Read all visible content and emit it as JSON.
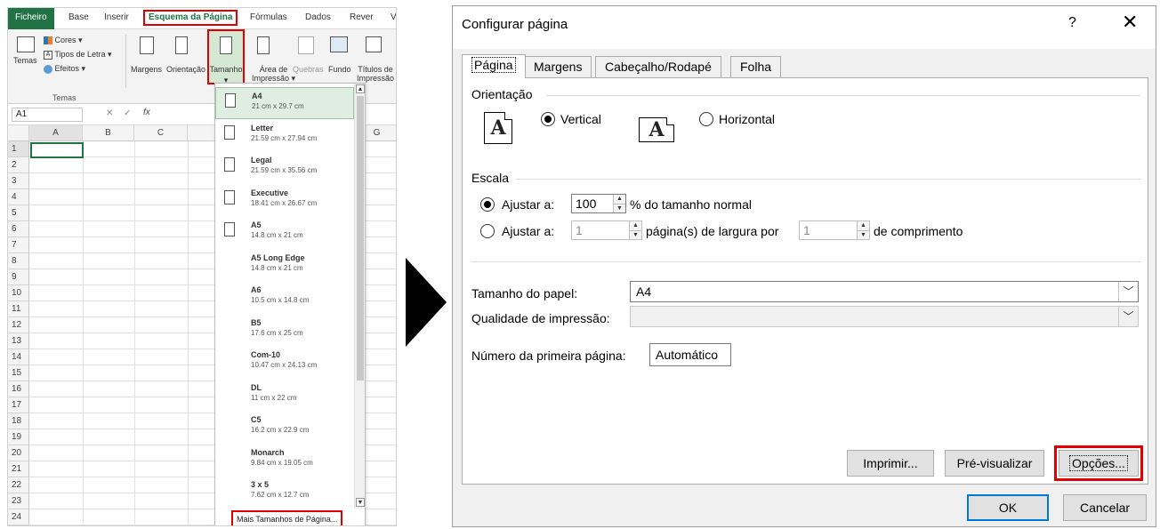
{
  "excel": {
    "menu_tabs": [
      "Ficheiro",
      "Base",
      "Inserir",
      "Esquema da Página",
      "Fórmulas",
      "Dados",
      "Rever",
      "V"
    ],
    "ribbon": {
      "temas_label": "Temas",
      "cores_label": "Cores",
      "tipos_letra_label": "Tipos de Letra",
      "efeitos_label": "Efeitos",
      "group_temas": "Temas",
      "margens_label": "Margens",
      "orientacao_label": "Orientação",
      "tamanho_label": "Tamanho",
      "area_label_1": "Área de",
      "area_label_2": "Impressão",
      "quebras_label": "Quebras",
      "fundo_label": "Fundo",
      "titulos_label_1": "Títulos de",
      "titulos_label_2": "Impressão"
    },
    "name_box": "A1",
    "fx_label": "fx",
    "columns": [
      "A",
      "B",
      "C",
      "G"
    ],
    "rows": [
      "1",
      "2",
      "3",
      "4",
      "5",
      "6",
      "7",
      "8",
      "9",
      "10",
      "11",
      "12",
      "13",
      "14",
      "15",
      "16",
      "17",
      "18",
      "19",
      "20",
      "21",
      "22",
      "23",
      "24"
    ],
    "paper_sizes": [
      {
        "name": "A4",
        "dims": "21 cm x 29.7 cm"
      },
      {
        "name": "Letter",
        "dims": "21.59 cm x 27.94 cm"
      },
      {
        "name": "Legal",
        "dims": "21.59 cm x 35.56 cm"
      },
      {
        "name": "Executive",
        "dims": "18.41 cm x 26.67 cm"
      },
      {
        "name": "A5",
        "dims": "14.8 cm x 21 cm"
      },
      {
        "name": "A5 Long Edge",
        "dims": "14.8 cm x 21 cm"
      },
      {
        "name": "A6",
        "dims": "10.5 cm x 14.8 cm"
      },
      {
        "name": "B5",
        "dims": "17.6 cm x 25 cm"
      },
      {
        "name": "Com-10",
        "dims": "10.47 cm x 24.13 cm"
      },
      {
        "name": "DL",
        "dims": "11 cm x 22 cm"
      },
      {
        "name": "C5",
        "dims": "16.2 cm x 22.9 cm"
      },
      {
        "name": "Monarch",
        "dims": "9.84 cm x 19.05 cm"
      },
      {
        "name": "3 x 5",
        "dims": "7.62 cm x 12.7 cm"
      }
    ],
    "more_sizes_label": "Mais Tamanhos de Página..."
  },
  "dialog": {
    "title": "Configurar página",
    "help_glyph": "?",
    "close_glyph": "✕",
    "tabs": [
      "Página",
      "Margens",
      "Cabeçalho/Rodapé",
      "Folha"
    ],
    "orientation_label": "Orientação",
    "vertical_label": "Vertical",
    "horizontal_label": "Horizontal",
    "page_glyph": "A",
    "scale_label": "Escala",
    "fit_label": "Ajustar a:",
    "fit_percent_value": "100",
    "fit_percent_suffix": "% do tamanho normal",
    "fit_pages_wide_value": "1",
    "fit_pages_mid": "página(s) de largura por",
    "fit_pages_tall_value": "1",
    "fit_pages_suffix": "de comprimento",
    "paper_size_label": "Tamanho do papel:",
    "paper_size_value": "A4",
    "print_quality_label": "Qualidade de impressão:",
    "print_quality_value": "",
    "first_page_label": "Número da primeira página:",
    "first_page_value": "Automático",
    "print_button": "Imprimir...",
    "preview_button": "Pré-visualizar",
    "options_button": "Opções...",
    "ok_button": "OK",
    "cancel_button": "Cancelar"
  },
  "colors": {
    "excel_green": "#217346",
    "highlight_red": "#e00000",
    "ok_border_blue": "#0078d7"
  }
}
